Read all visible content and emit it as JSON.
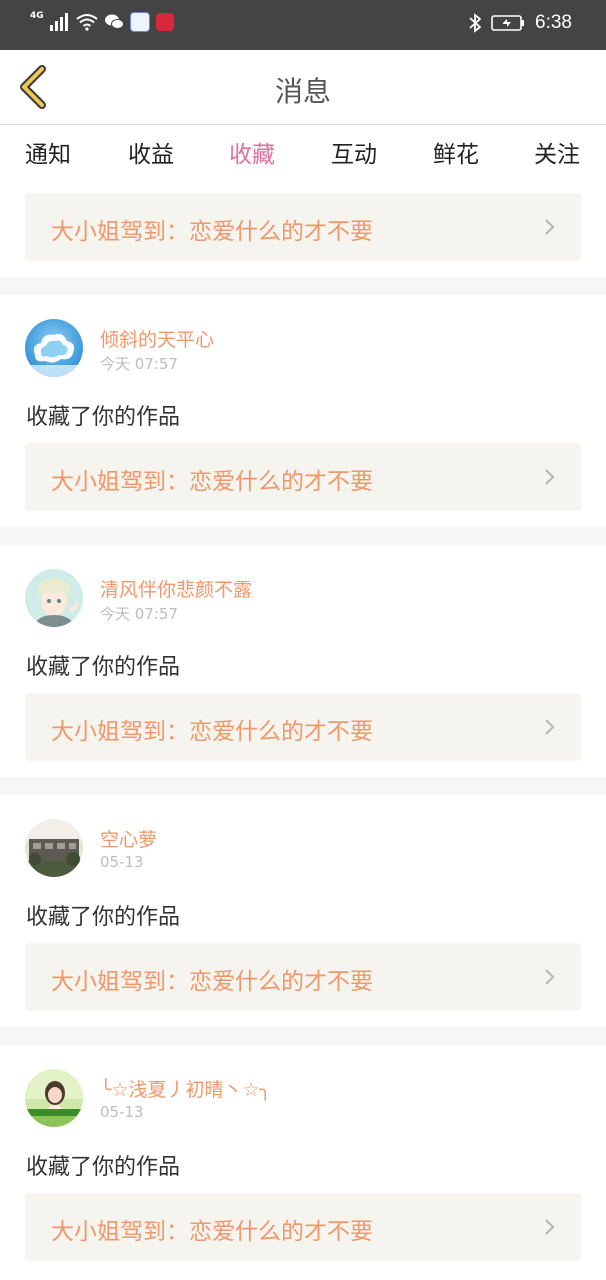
{
  "status_bar": {
    "network": "4G",
    "time": "6:38",
    "icons": [
      "signal-icon",
      "wifi-icon",
      "wechat-icon",
      "music-app-icon",
      "huawei-app-icon",
      "bluetooth-icon",
      "battery-icon"
    ]
  },
  "header": {
    "title": "消息",
    "back_icon": "back-chevron-icon"
  },
  "tabs": [
    {
      "label": "通知"
    },
    {
      "label": "收益"
    },
    {
      "label": "收藏",
      "active": true
    },
    {
      "label": "互动"
    },
    {
      "label": "鲜花"
    },
    {
      "label": "关注"
    }
  ],
  "top_item": {
    "work_title": "大小姐驾到：恋爱什么的才不要"
  },
  "messages": [
    {
      "user": "倾斜的天平心",
      "time": "今天 07:57",
      "action": "收藏了你的作品",
      "work_title": "大小姐驾到：恋爱什么的才不要"
    },
    {
      "user": "清风伴你悲颜不露",
      "time": "今天 07:57",
      "action": "收藏了你的作品",
      "work_title": "大小姐驾到：恋爱什么的才不要"
    },
    {
      "user": "空心萝",
      "time": "05-13",
      "action": "收藏了你的作品",
      "work_title": "大小姐驾到：恋爱什么的才不要"
    },
    {
      "user": "╰☆浅夏丿初晴丶☆╮",
      "time": "05-13",
      "action": "收藏了你的作品",
      "work_title": "大小姐驾到：恋爱什么的才不要"
    }
  ],
  "colors": {
    "accent": "#e0719f",
    "username": "#f0986b",
    "work_bg": "#f5f4ee",
    "status_bar": "#444444"
  }
}
